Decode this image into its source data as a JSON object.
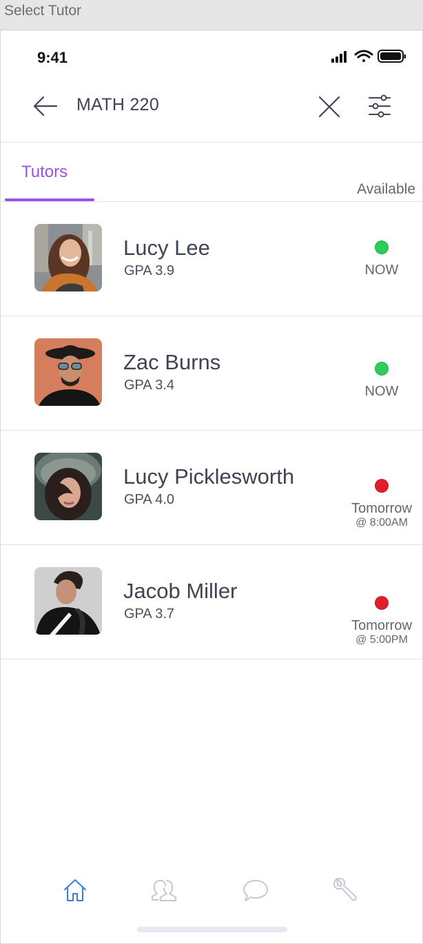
{
  "window": {
    "title": "Select Tutor"
  },
  "status_bar": {
    "time": "9:41"
  },
  "header": {
    "search_value": "MATH 220"
  },
  "tabs": {
    "active": "Tutors",
    "right_label": "Available"
  },
  "colors": {
    "accent": "#9b51e6",
    "available_now": "#2ecc5a",
    "unavailable": "#e01e2b",
    "nav_active": "#3b7be0",
    "nav_inactive": "#c3c8d4"
  },
  "tutors": [
    {
      "name": "Lucy Lee",
      "gpa": "GPA 3.9",
      "status": "now",
      "availability": "NOW",
      "availability_time": ""
    },
    {
      "name": "Zac Burns",
      "gpa": "GPA 3.4",
      "status": "now",
      "availability": "NOW",
      "availability_time": ""
    },
    {
      "name": "Lucy Picklesworth",
      "gpa": "GPA 4.0",
      "status": "later",
      "availability": "Tomorrow",
      "availability_time": "@ 8:00AM"
    },
    {
      "name": "Jacob Miller",
      "gpa": "GPA 3.7",
      "status": "later",
      "availability": "Tomorrow",
      "availability_time": "@ 5:00PM"
    }
  ],
  "bottom_nav": [
    {
      "icon": "home-icon",
      "active": true
    },
    {
      "icon": "people-icon",
      "active": false
    },
    {
      "icon": "chat-bubble-icon",
      "active": false
    },
    {
      "icon": "wrench-icon",
      "active": false
    }
  ]
}
